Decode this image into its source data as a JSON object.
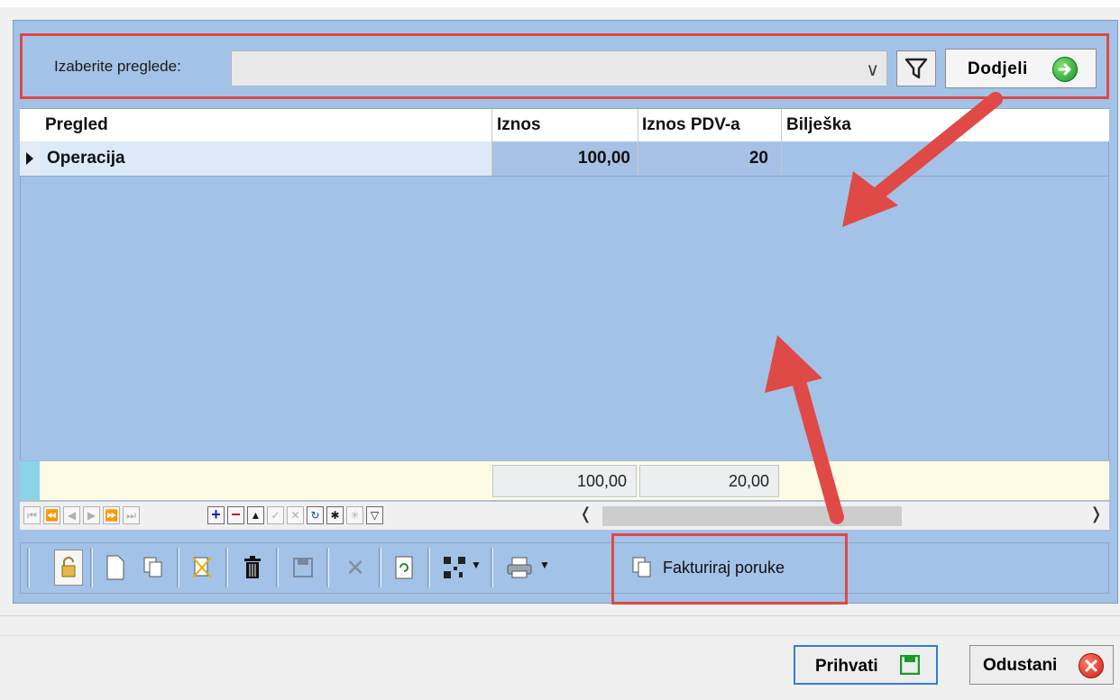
{
  "filter": {
    "label": "Izaberite preglede:",
    "combo_value": "",
    "assign_button": "Dodjeli"
  },
  "grid": {
    "columns": [
      "Pregled",
      "Iznos",
      "Iznos PDV-a",
      "Bilješka"
    ],
    "rows": [
      {
        "pregled": "Operacija",
        "iznos": "100,00",
        "iznos_pdv": "20",
        "biljeska": ""
      }
    ],
    "totals": {
      "iznos": "100,00",
      "iznos_pdv": "20,00"
    }
  },
  "toolbar": {
    "invoice_button": "Fakturiraj poruke"
  },
  "dialog": {
    "accept": "Prihvati",
    "cancel": "Odustani"
  },
  "colors": {
    "panel_bg": "#a3c2e8",
    "highlight_red": "#e04848",
    "totals_bg": "#fdfbe4"
  }
}
